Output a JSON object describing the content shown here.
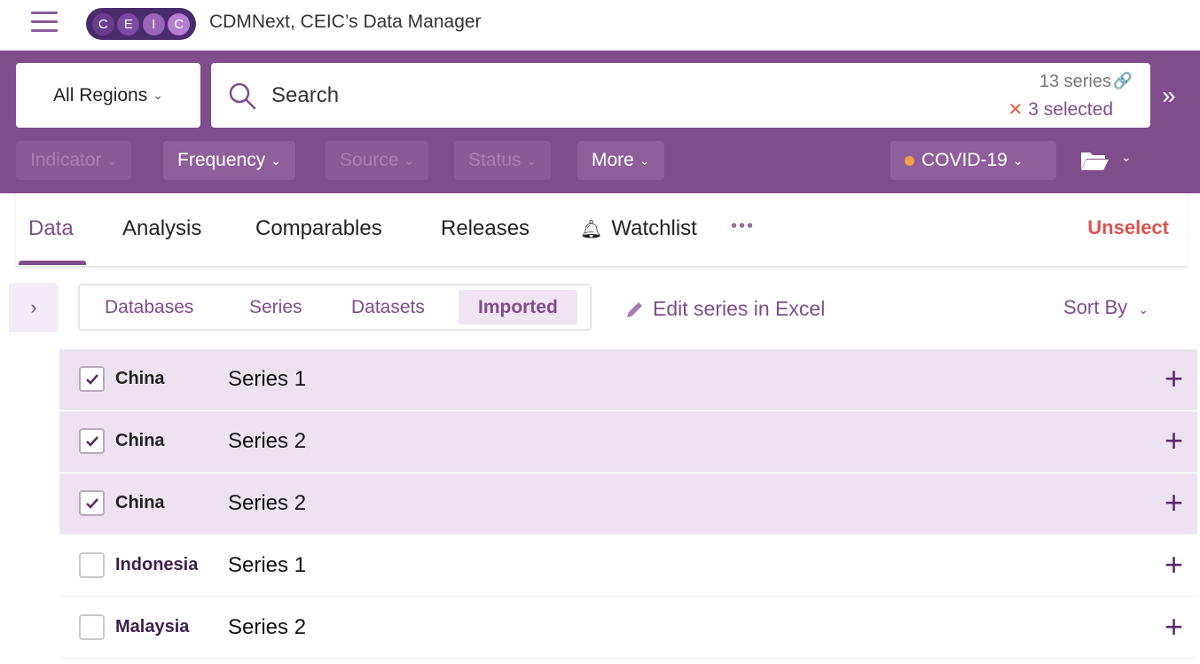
{
  "app": {
    "logo_letters": [
      "C",
      "E",
      "I",
      "C"
    ],
    "title": "CDMNext, CEIC’s Data Manager"
  },
  "header": {
    "region_label": "All Regions",
    "search_placeholder": "Search",
    "series_count": "13 series",
    "selected_count": "3 selected",
    "filters": [
      "Indicator",
      "Frequency",
      "Source",
      "Status",
      "More"
    ],
    "covid_label": "COVID-19"
  },
  "tabs": {
    "items": [
      "Data",
      "Analysis",
      "Comparables",
      "Releases",
      "Watchlist"
    ],
    "active": "Data",
    "unselect_label": "Unselect"
  },
  "subtabs": {
    "items": [
      "Databases",
      "Series",
      "Datasets",
      "Imported"
    ],
    "active": "Imported",
    "edit_excel_label": "Edit series in Excel",
    "sort_label": "Sort By"
  },
  "rows": [
    {
      "region": "China",
      "series": "Series 1",
      "checked": true
    },
    {
      "region": "China",
      "series": "Series 2",
      "checked": true
    },
    {
      "region": "China",
      "series": "Series 2",
      "checked": true
    },
    {
      "region": "Indonesia",
      "series": "Series 1",
      "checked": false
    },
    {
      "region": "Malaysia",
      "series": "Series 2",
      "checked": false
    }
  ],
  "colors": {
    "brand_purple": "#7f4c8c",
    "alert_red": "#d9534f",
    "covid_dot": "#f5a04a"
  }
}
